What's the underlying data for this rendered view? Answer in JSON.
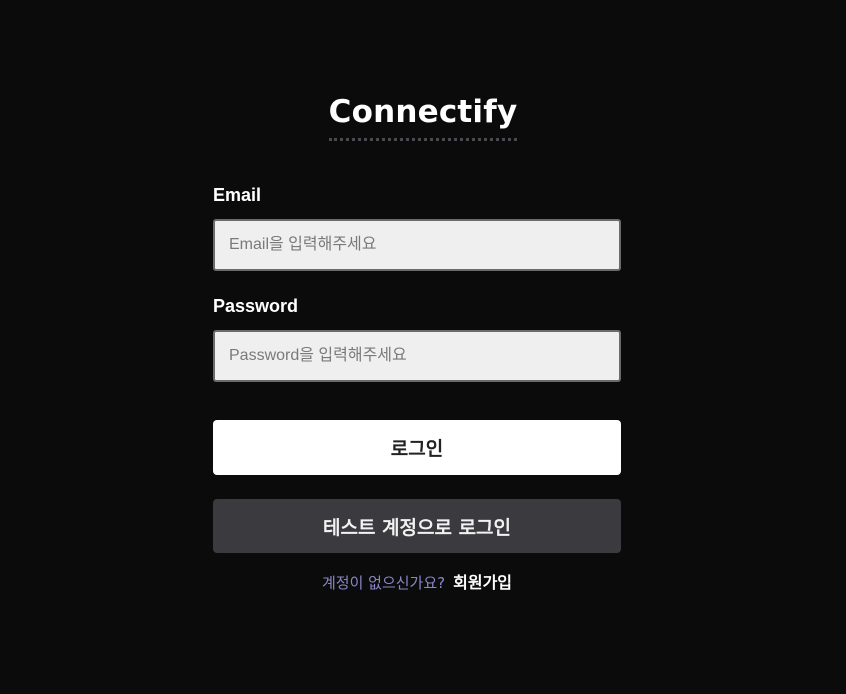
{
  "app": {
    "logo_text": "Connectify"
  },
  "login_form": {
    "email": {
      "label": "Email",
      "value": "",
      "placeholder": "Email을 입력해주세요"
    },
    "password": {
      "label": "Password",
      "value": "",
      "placeholder": "Password을 입력해주세요"
    },
    "login_button_label": "로그인",
    "test_login_button_label": "테스트 계정으로 로그인",
    "signup_prompt": "계정이 없으신가요?",
    "signup_link_label": "회원가입"
  },
  "colors": {
    "background": "#0b0b0b",
    "input_background": "#efefef",
    "primary_button": "#ffffff",
    "secondary_button": "#3a3a3f",
    "signup_prompt": "#8b86c8"
  }
}
